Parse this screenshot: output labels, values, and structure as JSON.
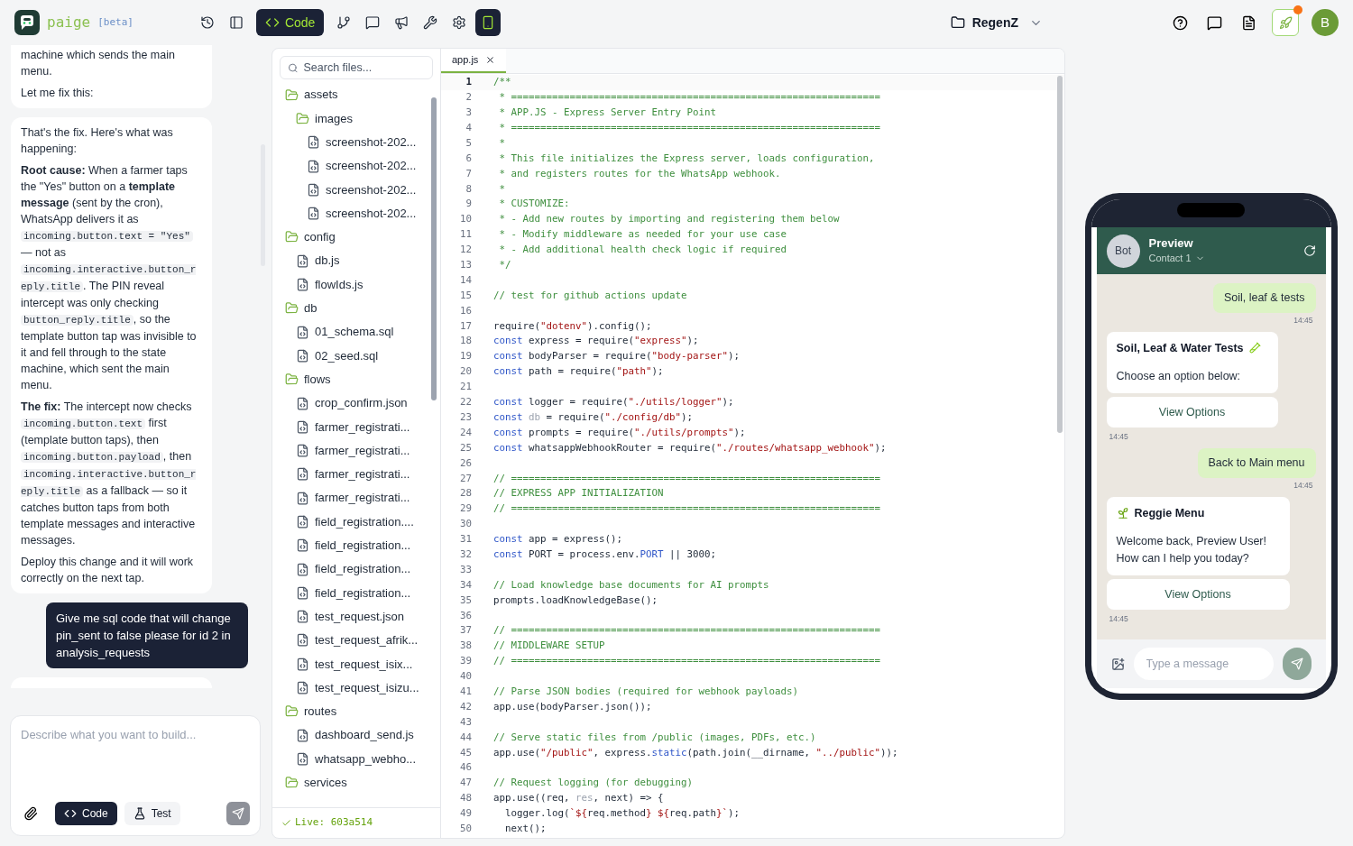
{
  "app": {
    "name": "paige",
    "badge": "[beta]"
  },
  "toolbar": [
    {
      "selected": false
    },
    {
      "selected": false
    },
    {
      "label": "Code",
      "selected": true
    },
    {
      "selected": false
    },
    {
      "selected": false
    },
    {
      "selected": false
    },
    {
      "selected": false
    },
    {
      "selected": false
    },
    {
      "selected": true
    }
  ],
  "project": {
    "name": "RegenZ"
  },
  "deploy": {
    "notification": true
  },
  "user": {
    "initial": "B"
  },
  "chat": {
    "messages": [
      {
        "kind": "assistant",
        "paragraphs": [
          [
            {
              "kind": "text",
              "text": "machine which sends the main menu."
            }
          ],
          [
            {
              "kind": "text",
              "text": "Let me fix this:"
            }
          ]
        ]
      },
      {
        "kind": "assistant",
        "paragraphs": [
          [
            {
              "kind": "text",
              "text": "That's the fix. Here's what was happening:"
            }
          ],
          [
            {
              "kind": "text",
              "text": "**Root cause:** When a farmer taps the \"Yes\" button on a **template message** (sent by the cron), WhatsApp delivers it as "
            },
            {
              "kind": "code",
              "text": "incoming.button.text = \"Yes\""
            },
            {
              "kind": "text",
              "text": " — not as "
            },
            {
              "kind": "code",
              "text": "incoming.interactive.button_reply.title"
            },
            {
              "kind": "text",
              "text": ". The PIN reveal intercept was only checking "
            },
            {
              "kind": "code",
              "text": "button_reply.title"
            },
            {
              "kind": "text",
              "text": ", so the template button tap was invisible to it and fell through to the state machine, which sent the main menu."
            }
          ],
          [
            {
              "kind": "text",
              "text": "**The fix:** The intercept now checks "
            },
            {
              "kind": "code",
              "text": "incoming.button.text"
            },
            {
              "kind": "text",
              "text": " first (template button taps), then "
            },
            {
              "kind": "code",
              "text": "incoming.button.payload"
            },
            {
              "kind": "text",
              "text": ", then "
            },
            {
              "kind": "code",
              "text": "incoming.interactive.button_reply.title"
            },
            {
              "kind": "text",
              "text": " as a fallback — so it catches button taps from both template messages and interactive messages."
            }
          ],
          [
            {
              "kind": "text",
              "text": "Deploy this change and it will work correctly on the next tap."
            }
          ]
        ]
      },
      {
        "kind": "user",
        "text": "Give me sql code that will change pin_sent to false please for id 2 in analysis_requests"
      },
      {
        "kind": "assistant"
      }
    ],
    "input": {
      "placeholder": "Describe what you want to build...",
      "modes": [
        {
          "label": "Code",
          "selected": true
        },
        {
          "label": "Test",
          "selected": false
        }
      ]
    }
  },
  "files": {
    "search_placeholder": "Search files...",
    "tree": [
      {
        "kind": "folder",
        "name": "assets",
        "expanded": true,
        "children": [
          {
            "kind": "folder",
            "name": "images",
            "expanded": true,
            "children": [
              {
                "kind": "file",
                "name": "screenshot-202..."
              },
              {
                "kind": "file",
                "name": "screenshot-202..."
              },
              {
                "kind": "file",
                "name": "screenshot-202..."
              },
              {
                "kind": "file",
                "name": "screenshot-202..."
              }
            ]
          }
        ]
      },
      {
        "kind": "folder",
        "name": "config",
        "expanded": true,
        "children": [
          {
            "kind": "file",
            "name": "db.js"
          },
          {
            "kind": "file",
            "name": "flowIds.js"
          }
        ]
      },
      {
        "kind": "folder",
        "name": "db",
        "expanded": true,
        "children": [
          {
            "kind": "file",
            "name": "01_schema.sql"
          },
          {
            "kind": "file",
            "name": "02_seed.sql"
          }
        ]
      },
      {
        "kind": "folder",
        "name": "flows",
        "expanded": true,
        "children": [
          {
            "kind": "file",
            "name": "crop_confirm.json"
          },
          {
            "kind": "file",
            "name": "farmer_registrati..."
          },
          {
            "kind": "file",
            "name": "farmer_registrati..."
          },
          {
            "kind": "file",
            "name": "farmer_registrati..."
          },
          {
            "kind": "file",
            "name": "farmer_registrati..."
          },
          {
            "kind": "file",
            "name": "field_registration...."
          },
          {
            "kind": "file",
            "name": "field_registration..."
          },
          {
            "kind": "file",
            "name": "field_registration..."
          },
          {
            "kind": "file",
            "name": "field_registration..."
          },
          {
            "kind": "file",
            "name": "test_request.json"
          },
          {
            "kind": "file",
            "name": "test_request_afrik..."
          },
          {
            "kind": "file",
            "name": "test_request_isix..."
          },
          {
            "kind": "file",
            "name": "test_request_isizu..."
          }
        ]
      },
      {
        "kind": "folder",
        "name": "routes",
        "expanded": true,
        "children": [
          {
            "kind": "file",
            "name": "dashboard_send.js"
          },
          {
            "kind": "file",
            "name": "whatsapp_webho..."
          }
        ]
      },
      {
        "kind": "folder",
        "name": "services",
        "expanded": true
      }
    ],
    "status": "Live: 603a514"
  },
  "editor": {
    "tabs": [
      {
        "label": "app.js",
        "selected": true
      }
    ],
    "lines": [
      {
        "n": "1",
        "active": true,
        "tokens": [
          {
            "kind": "comment",
            "text": "/**"
          }
        ]
      },
      {
        "n": "2",
        "active": false,
        "tokens": [
          {
            "kind": "comment",
            "text": " * ==============================================================="
          }
        ]
      },
      {
        "n": "3",
        "active": false,
        "tokens": [
          {
            "kind": "comment",
            "text": " * APP.JS - Express Server Entry Point"
          }
        ]
      },
      {
        "n": "4",
        "active": false,
        "tokens": [
          {
            "kind": "comment",
            "text": " * ==============================================================="
          }
        ]
      },
      {
        "n": "5",
        "active": false,
        "tokens": [
          {
            "kind": "comment",
            "text": " *"
          }
        ]
      },
      {
        "n": "6",
        "active": false,
        "tokens": [
          {
            "kind": "comment",
            "text": " * This file initializes the Express server, loads configuration,"
          }
        ]
      },
      {
        "n": "7",
        "active": false,
        "tokens": [
          {
            "kind": "comment",
            "text": " * and registers routes for the WhatsApp webhook."
          }
        ]
      },
      {
        "n": "8",
        "active": false,
        "tokens": [
          {
            "kind": "comment",
            "text": " *"
          }
        ]
      },
      {
        "n": "9",
        "active": false,
        "tokens": [
          {
            "kind": "comment",
            "text": " * CUSTOMIZE:"
          }
        ]
      },
      {
        "n": "10",
        "active": false,
        "tokens": [
          {
            "kind": "comment",
            "text": " * - Add new routes by importing and registering them below"
          }
        ]
      },
      {
        "n": "11",
        "active": false,
        "tokens": [
          {
            "kind": "comment",
            "text": " * - Modify middleware as needed for your use case"
          }
        ]
      },
      {
        "n": "12",
        "active": false,
        "tokens": [
          {
            "kind": "comment",
            "text": " * - Add additional health check logic if required"
          }
        ]
      },
      {
        "n": "13",
        "active": false,
        "tokens": [
          {
            "kind": "comment",
            "text": " */"
          }
        ]
      },
      {
        "n": "14",
        "active": false
      },
      {
        "n": "15",
        "active": false,
        "tokens": [
          {
            "kind": "comment",
            "text": "// test for github actions update"
          }
        ]
      },
      {
        "n": "16",
        "active": false
      },
      {
        "n": "17",
        "active": false,
        "tokens": [
          {
            "kind": "plain",
            "text": "require("
          },
          {
            "kind": "string",
            "text": "\"dotenv\""
          },
          {
            "kind": "plain",
            "text": ").config();"
          }
        ]
      },
      {
        "n": "18",
        "active": false,
        "tokens": [
          {
            "kind": "keyword",
            "text": "const"
          },
          {
            "kind": "plain",
            "text": " express = require("
          },
          {
            "kind": "string",
            "text": "\"express\""
          },
          {
            "kind": "plain",
            "text": ");"
          }
        ]
      },
      {
        "n": "19",
        "active": false,
        "tokens": [
          {
            "kind": "keyword",
            "text": "const"
          },
          {
            "kind": "plain",
            "text": " bodyParser = require("
          },
          {
            "kind": "string",
            "text": "\"body-parser\""
          },
          {
            "kind": "plain",
            "text": ");"
          }
        ]
      },
      {
        "n": "20",
        "active": false,
        "tokens": [
          {
            "kind": "keyword",
            "text": "const"
          },
          {
            "kind": "plain",
            "text": " path = require("
          },
          {
            "kind": "string",
            "text": "\"path\""
          },
          {
            "kind": "plain",
            "text": ");"
          }
        ]
      },
      {
        "n": "21",
        "active": false
      },
      {
        "n": "22",
        "active": false,
        "tokens": [
          {
            "kind": "keyword",
            "text": "const"
          },
          {
            "kind": "plain",
            "text": " logger = require("
          },
          {
            "kind": "string",
            "text": "\"./utils/logger\""
          },
          {
            "kind": "plain",
            "text": ");"
          }
        ]
      },
      {
        "n": "23",
        "active": false,
        "tokens": [
          {
            "kind": "keyword",
            "text": "const"
          },
          {
            "kind": "dim",
            "text": " db"
          },
          {
            "kind": "plain",
            "text": " = require("
          },
          {
            "kind": "string",
            "text": "\"./config/db\""
          },
          {
            "kind": "plain",
            "text": ");"
          }
        ]
      },
      {
        "n": "24",
        "active": false,
        "tokens": [
          {
            "kind": "keyword",
            "text": "const"
          },
          {
            "kind": "plain",
            "text": " prompts = require("
          },
          {
            "kind": "string",
            "text": "\"./utils/prompts\""
          },
          {
            "kind": "plain",
            "text": ");"
          }
        ]
      },
      {
        "n": "25",
        "active": false,
        "tokens": [
          {
            "kind": "keyword",
            "text": "const"
          },
          {
            "kind": "plain",
            "text": " whatsappWebhookRouter = require("
          },
          {
            "kind": "string",
            "text": "\"./routes/whatsapp_webhook\""
          },
          {
            "kind": "plain",
            "text": ");"
          }
        ]
      },
      {
        "n": "26",
        "active": false
      },
      {
        "n": "27",
        "active": false,
        "tokens": [
          {
            "kind": "comment",
            "text": "// ==============================================================="
          }
        ]
      },
      {
        "n": "28",
        "active": false,
        "tokens": [
          {
            "kind": "comment",
            "text": "// EXPRESS APP INITIALIZATION"
          }
        ]
      },
      {
        "n": "29",
        "active": false,
        "tokens": [
          {
            "kind": "comment",
            "text": "// ==============================================================="
          }
        ]
      },
      {
        "n": "30",
        "active": false
      },
      {
        "n": "31",
        "active": false,
        "tokens": [
          {
            "kind": "keyword",
            "text": "const"
          },
          {
            "kind": "plain",
            "text": " app = express();"
          }
        ]
      },
      {
        "n": "32",
        "active": false,
        "tokens": [
          {
            "kind": "keyword",
            "text": "const"
          },
          {
            "kind": "plain",
            "text": " PORT = process.env."
          },
          {
            "kind": "keyword",
            "text": "PORT"
          },
          {
            "kind": "plain",
            "text": " || "
          },
          {
            "kind": "number",
            "text": "3000"
          },
          {
            "kind": "plain",
            "text": ";"
          }
        ]
      },
      {
        "n": "33",
        "active": false
      },
      {
        "n": "34",
        "active": false,
        "tokens": [
          {
            "kind": "comment",
            "text": "// Load knowledge base documents for AI prompts"
          }
        ]
      },
      {
        "n": "35",
        "active": false,
        "tokens": [
          {
            "kind": "plain",
            "text": "prompts.loadKnowledgeBase();"
          }
        ]
      },
      {
        "n": "36",
        "active": false
      },
      {
        "n": "37",
        "active": false,
        "tokens": [
          {
            "kind": "comment",
            "text": "// ==============================================================="
          }
        ]
      },
      {
        "n": "38",
        "active": false,
        "tokens": [
          {
            "kind": "comment",
            "text": "// MIDDLEWARE SETUP"
          }
        ]
      },
      {
        "n": "39",
        "active": false,
        "tokens": [
          {
            "kind": "comment",
            "text": "// ==============================================================="
          }
        ]
      },
      {
        "n": "40",
        "active": false
      },
      {
        "n": "41",
        "active": false,
        "tokens": [
          {
            "kind": "comment",
            "text": "// Parse JSON bodies (required for webhook payloads)"
          }
        ]
      },
      {
        "n": "42",
        "active": false,
        "tokens": [
          {
            "kind": "plain",
            "text": "app.use(bodyParser.json());"
          }
        ]
      },
      {
        "n": "43",
        "active": false
      },
      {
        "n": "44",
        "active": false,
        "tokens": [
          {
            "kind": "comment",
            "text": "// Serve static files from /public (images, PDFs, etc.)"
          }
        ]
      },
      {
        "n": "45",
        "active": false,
        "tokens": [
          {
            "kind": "plain",
            "text": "app.use("
          },
          {
            "kind": "string",
            "text": "\"/public\""
          },
          {
            "kind": "plain",
            "text": ", express."
          },
          {
            "kind": "keyword",
            "text": "static"
          },
          {
            "kind": "plain",
            "text": "(path.join(__dirname, "
          },
          {
            "kind": "string",
            "text": "\"../public\""
          },
          {
            "kind": "plain",
            "text": "));"
          }
        ]
      },
      {
        "n": "46",
        "active": false
      },
      {
        "n": "47",
        "active": false,
        "tokens": [
          {
            "kind": "comment",
            "text": "// Request logging (for debugging)"
          }
        ]
      },
      {
        "n": "48",
        "active": false,
        "tokens": [
          {
            "kind": "plain",
            "text": "app.use((req, "
          },
          {
            "kind": "dim",
            "text": "res"
          },
          {
            "kind": "plain",
            "text": ", next) => {"
          }
        ]
      },
      {
        "n": "49",
        "active": false,
        "tokens": [
          {
            "kind": "plain",
            "text": "  logger.log("
          },
          {
            "kind": "string",
            "text": "`${"
          },
          {
            "kind": "plain",
            "text": "req.method"
          },
          {
            "kind": "string",
            "text": "} ${"
          },
          {
            "kind": "plain",
            "text": "req.path"
          },
          {
            "kind": "string",
            "text": "}`"
          },
          {
            "kind": "plain",
            "text": ");"
          }
        ]
      },
      {
        "n": "50",
        "active": false,
        "tokens": [
          {
            "kind": "plain",
            "text": "  next();"
          }
        ]
      }
    ]
  },
  "preview": {
    "avatar": "Bot",
    "title": "Preview",
    "contact": "Contact 1",
    "messages": [
      {
        "kind": "sent",
        "text": "Soil, leaf & tests",
        "time": "14:45"
      },
      {
        "kind": "card",
        "title": "Soil, Leaf & Water Tests",
        "body": "Choose an option below:",
        "button": "View Options",
        "time": "14:45"
      },
      {
        "kind": "sent",
        "text": "Back to Main menu",
        "time": "14:45"
      },
      {
        "kind": "card",
        "title": "Reggie Menu",
        "body": "Welcome back, Preview User! How can I help you today?",
        "button": "View Options",
        "time": "14:45"
      }
    ],
    "input": {
      "placeholder": "Type a message"
    }
  }
}
